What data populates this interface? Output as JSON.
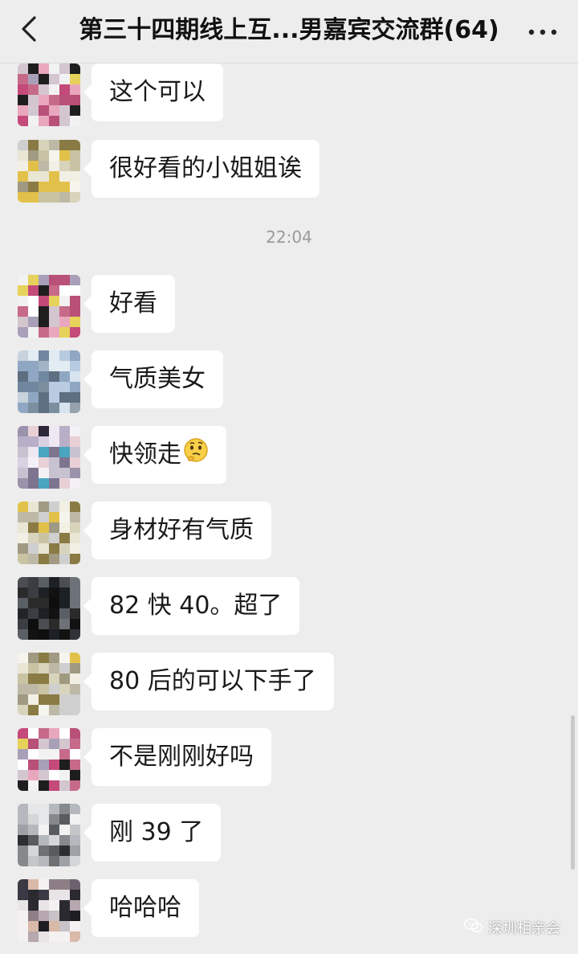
{
  "header": {
    "title": "第三十四期线上互...男嘉宾交流群(64)",
    "back_icon": "chevron-left-icon",
    "more_icon": "more-dots-icon"
  },
  "messages_before": [
    {
      "text": "这个可以",
      "avatar": "pink"
    },
    {
      "text": "很好看的小姐姐诶",
      "avatar": "beige"
    }
  ],
  "timestamp": "22:04",
  "messages_after": [
    {
      "text": "好看",
      "avatar": "pink"
    },
    {
      "text": "气质美女",
      "avatar": "blue"
    },
    {
      "text": "快领走",
      "avatar": "lavender",
      "emoji": "thinking-face-icon"
    },
    {
      "text": "身材好有气质",
      "avatar": "beige"
    },
    {
      "text": "82 快 40。超了",
      "avatar": "dark"
    },
    {
      "text": "80 后的可以下手了",
      "avatar": "beige"
    },
    {
      "text": "不是刚刚好吗",
      "avatar": "pink"
    },
    {
      "text": "刚 39 了",
      "avatar": "gray"
    },
    {
      "text": "哈哈哈",
      "avatar": "portrait"
    }
  ],
  "watermark": {
    "text": "深圳相亲会",
    "icon": "wechat-channel-icon"
  },
  "colors": {
    "background": "#ededed",
    "bubble": "#ffffff",
    "text": "#1a1a1a",
    "timestamp": "#9a9a9a"
  }
}
